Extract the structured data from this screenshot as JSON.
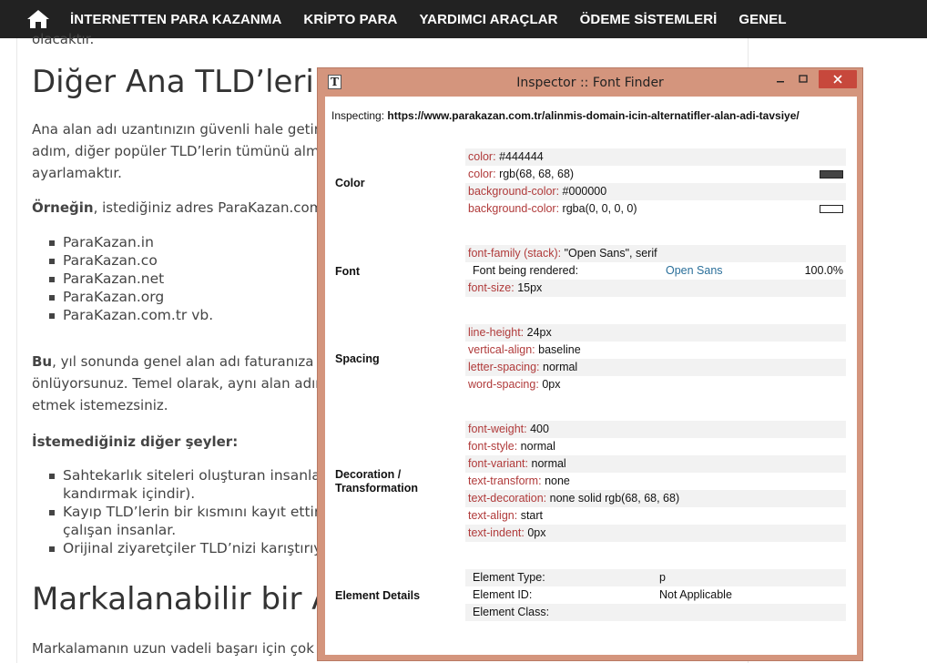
{
  "nav": {
    "items": [
      "İNTERNETTEN PARA KAZANMA",
      "KRİPTO PARA",
      "YARDIMCI ARAÇLAR",
      "ÖDEME SİSTEMLERİ",
      "GENEL"
    ]
  },
  "article": {
    "cut_line": "olacaktır.",
    "heading1": "Diğer Ana TLD’leri d",
    "para1": [
      "Ana alan adı uzantınızın güvenli hale getirilme",
      "adım, diğer popüler TLD’lerin tümünü almak",
      "ayarlamaktır."
    ],
    "para2_bold": "Örneğin",
    "para2_rest": ", istediğiniz adres ParaKazan.com ise",
    "list1": [
      "ParaKazan.in",
      "ParaKazan.co",
      "ParaKazan.net",
      "ParaKazan.org",
      "ParaKazan.com.tr vb."
    ],
    "para3_bold": "Bu",
    "para3_rest": ", yıl sonunda genel alan adı faturanıza katk",
    "para3_lines": [
      "önlüyorsunuz. Temel olarak, aynı alan adına s",
      "etmek istemezsiniz."
    ],
    "para4": "İstemediğiniz diğer şeyler:",
    "list2": [
      {
        "l1": "Sahtekarlık siteleri oluşturan insanlar",
        "l2": "kandırmak içindir)."
      },
      {
        "l1": "Kayıp TLD’lerin bir kısmını kayıt ettirer",
        "l2": "çalışan insanlar."
      },
      {
        "l1": "Orijinal ziyaretçiler TLD’nizi karıştırıyo",
        "l2": ""
      }
    ],
    "heading2": "Markalanabilir bir A",
    "para5": "Markalamanın uzun vadeli başarı için çok öne"
  },
  "inspector": {
    "title": "Inspector :: Font Finder",
    "app_icon": "T",
    "inspecting_label": "Inspecting:",
    "inspecting_url": "https://www.parakazan.com.tr/alinmis-domain-icin-alternatifler-alan-adi-tavsiye/",
    "sections": {
      "color": {
        "label": "Color",
        "rows": [
          {
            "prop": "color:",
            "val": "#444444"
          },
          {
            "prop": "color:",
            "val": "rgb(68, 68, 68)"
          },
          {
            "prop": "background-color:",
            "val": "#000000"
          },
          {
            "prop": "background-color:",
            "val": "rgba(0, 0, 0, 0)"
          }
        ],
        "swatch_dark": "#444444",
        "swatch_clear": "#ffffff"
      },
      "font": {
        "label": "Font",
        "family_prop": "font-family (stack):",
        "family_val": "\"Open Sans\", serif",
        "rendered_label": "Font being rendered:",
        "rendered_font": "Open Sans",
        "rendered_pct": "100.0%",
        "size_prop": "font-size:",
        "size_val": "15px"
      },
      "spacing": {
        "label": "Spacing",
        "rows": [
          {
            "prop": "line-height:",
            "val": "24px"
          },
          {
            "prop": "vertical-align:",
            "val": "baseline"
          },
          {
            "prop": "letter-spacing:",
            "val": "normal"
          },
          {
            "prop": "word-spacing:",
            "val": "0px"
          }
        ]
      },
      "decoration": {
        "label1": "Decoration /",
        "label2": "Transformation",
        "rows": [
          {
            "prop": "font-weight:",
            "val": "400"
          },
          {
            "prop": "font-style:",
            "val": "normal"
          },
          {
            "prop": "font-variant:",
            "val": "normal"
          },
          {
            "prop": "text-transform:",
            "val": "none"
          },
          {
            "prop": "text-decoration:",
            "val": "none solid rgb(68, 68, 68)"
          },
          {
            "prop": "text-align:",
            "val": "start"
          },
          {
            "prop": "text-indent:",
            "val": "0px"
          }
        ]
      },
      "element": {
        "label": "Element Details",
        "rows": [
          {
            "key": "Element Type:",
            "val": "p"
          },
          {
            "key": "Element ID:",
            "val": "Not Applicable"
          },
          {
            "key": "Element Class:",
            "val": ""
          }
        ]
      }
    }
  }
}
